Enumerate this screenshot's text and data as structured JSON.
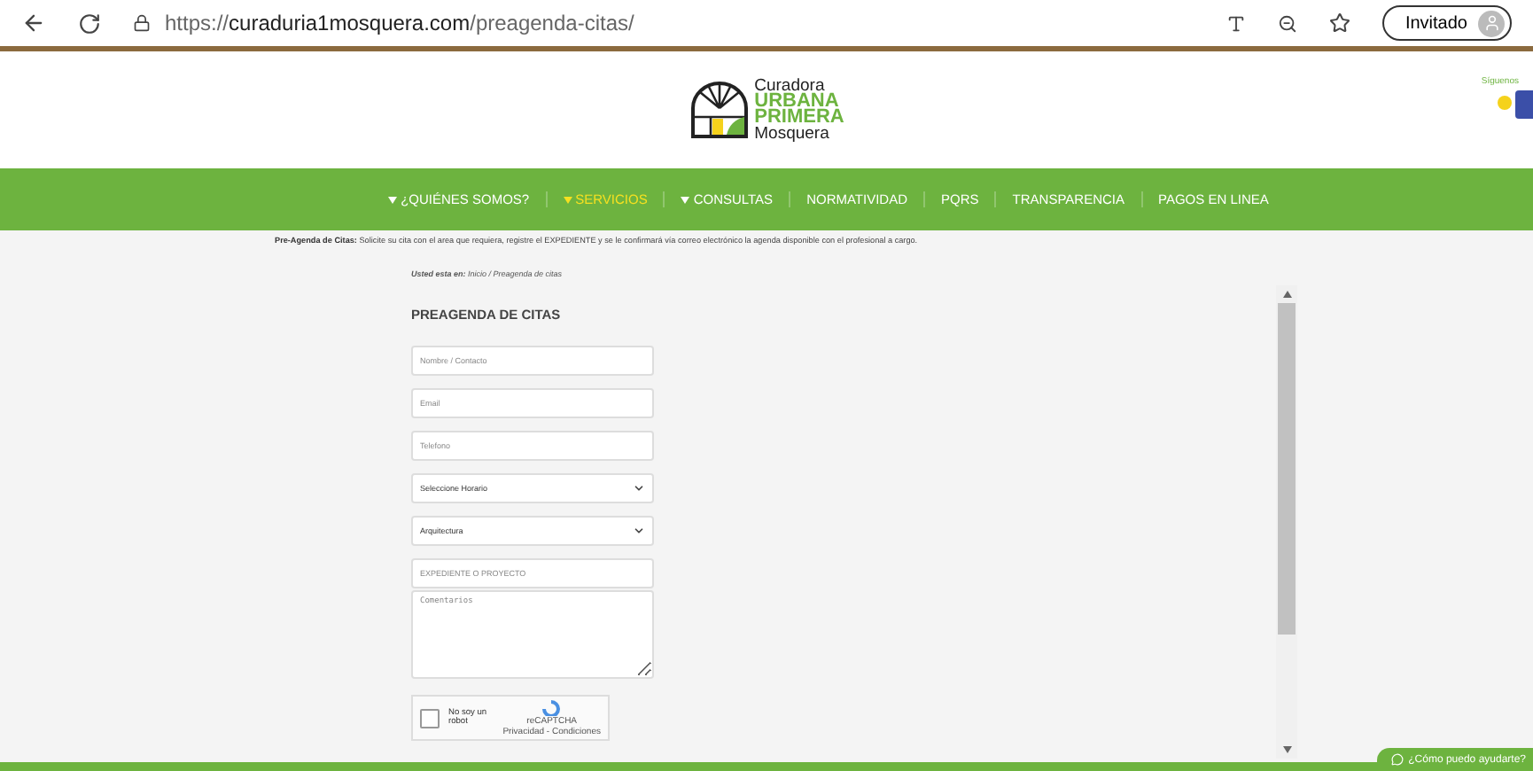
{
  "browser": {
    "url_host": "curaduria1mosquera.com",
    "url_scheme": "https://",
    "url_path": "/preagenda-citas/",
    "profile_label": "Invitado"
  },
  "header": {
    "logo_lines": [
      "Curadora",
      "URBANA",
      "PRIMERA",
      "Mosquera"
    ],
    "social_label": "Síguenos"
  },
  "nav": [
    {
      "label": "¿QUIÉNES SOMOS?",
      "has_caret": true,
      "selected": false
    },
    {
      "label": "SERVICIOS",
      "has_caret": true,
      "selected": true
    },
    {
      "label": "CONSULTAS",
      "has_caret": true,
      "selected": false
    },
    {
      "label": "NORMATIVIDAD",
      "has_caret": false,
      "selected": false
    },
    {
      "label": "PQRS",
      "has_caret": false,
      "selected": false
    },
    {
      "label": "TRANSPARENCIA",
      "has_caret": false,
      "selected": false
    },
    {
      "label": "PAGOS EN LINEA",
      "has_caret": false,
      "selected": false
    }
  ],
  "notice": "**Pre-Agenda de Citas:** Solicite su cita con el area que requiera, registre el EXPEDIENTE y se le confirmará vía correo electrónico la agenda disponible con el profesional a cargo.",
  "breadcrumb": "**Usted esta en:** Inicio / Preagenda de citas",
  "form": {
    "title": "PREAGENDA DE CITAS",
    "fields": [
      {
        "kind": "input",
        "placeholder": "Nombre / Contacto"
      },
      {
        "kind": "input",
        "placeholder": "Email"
      },
      {
        "kind": "input",
        "placeholder": "Telefono"
      },
      {
        "kind": "select",
        "value": "Seleccione Horario"
      },
      {
        "kind": "select",
        "value": "Arquitectura"
      },
      {
        "kind": "input",
        "placeholder": "EXPEDIENTE O PROYECTO"
      },
      {
        "kind": "textarea",
        "placeholder": "Comentarios"
      }
    ],
    "captcha": {
      "label": "No soy un robot",
      "checked": false,
      "brand": "reCAPTCHA",
      "links": "Privacidad - Condiciones"
    }
  },
  "chat_button": "¿Cómo puedo ayudarte?"
}
